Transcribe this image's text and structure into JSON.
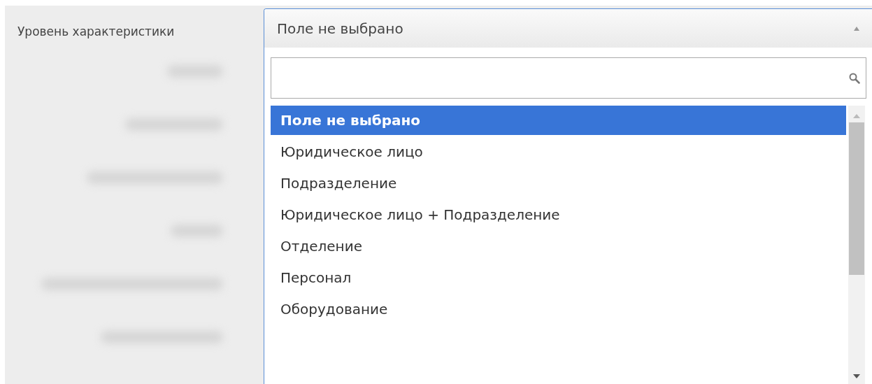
{
  "field": {
    "label": "Уровень характеристики"
  },
  "redacted_labels": [
    {
      "kind": "blurred"
    },
    {
      "kind": "blurred"
    },
    {
      "kind": "blurred"
    },
    {
      "kind": "blurred"
    },
    {
      "kind": "blurred"
    },
    {
      "kind": "blurred"
    }
  ],
  "dropdown": {
    "value": "Поле не выбрано",
    "expanded": true,
    "options": [
      {
        "label": "Поле не выбрано",
        "selected": true
      },
      {
        "label": "Юридическое лицо",
        "selected": false
      },
      {
        "label": "Подразделение",
        "selected": false
      },
      {
        "label": "Юридическое лицо + Подразделение",
        "selected": false
      },
      {
        "label": "Отделение",
        "selected": false
      },
      {
        "label": "Персонал",
        "selected": false
      },
      {
        "label": "Оборудование",
        "selected": false
      }
    ]
  }
}
